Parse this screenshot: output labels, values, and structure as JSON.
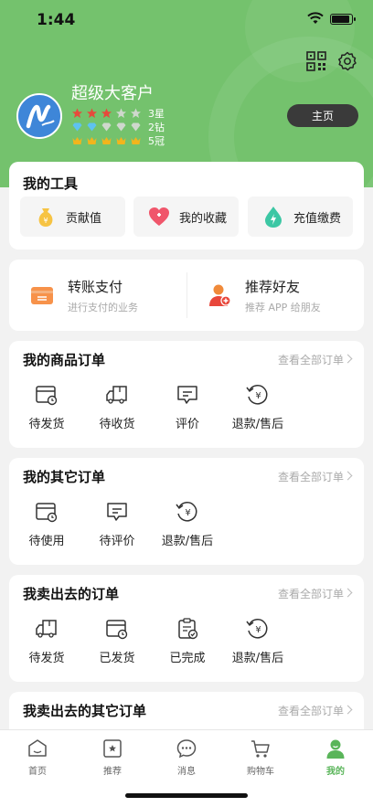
{
  "status_bar": {
    "time": "1:44"
  },
  "header": {
    "icons": [
      "qr-code-icon",
      "gear-icon"
    ],
    "user_name": "超级大客户",
    "levels": [
      {
        "label": "3星",
        "icon": "star-icon"
      },
      {
        "label": "2钻",
        "icon": "diamond-icon"
      },
      {
        "label": "5冠",
        "icon": "crown-icon"
      }
    ],
    "home_button": "主页"
  },
  "tools": {
    "title": "我的工具",
    "items": [
      {
        "label": "贡献值",
        "icon": "money-bag-icon"
      },
      {
        "label": "我的收藏",
        "icon": "heart-icon"
      },
      {
        "label": "充值缴费",
        "icon": "water-drop-icon"
      }
    ]
  },
  "pay": {
    "items": [
      {
        "title": "转账支付",
        "subtitle": "进行支付的业务",
        "icon": "wallet-icon"
      },
      {
        "title": "推荐好友",
        "subtitle": "推荐 APP 给朋友",
        "icon": "user-add-icon"
      }
    ]
  },
  "orders": {
    "see_all": "查看全部订单",
    "goods": {
      "title": "我的商品订单",
      "items": [
        "待发货",
        "待收货",
        "评价",
        "退款/售后"
      ]
    },
    "other": {
      "title": "我的其它订单",
      "items": [
        "待使用",
        "待评价",
        "退款/售后"
      ]
    },
    "sold": {
      "title": "我卖出去的订单",
      "items": [
        "待发货",
        "已发货",
        "已完成",
        "退款/售后"
      ]
    },
    "sold_other": {
      "title": "我卖出去的其它订单"
    }
  },
  "tabbar": {
    "items": [
      {
        "label": "首页",
        "icon": "home-icon"
      },
      {
        "label": "推荐",
        "icon": "recommend-icon"
      },
      {
        "label": "消息",
        "icon": "message-icon"
      },
      {
        "label": "购物车",
        "icon": "cart-icon"
      },
      {
        "label": "我的",
        "icon": "profile-icon"
      }
    ],
    "active_index": 4
  },
  "colors": {
    "brand_green": "#74c26d",
    "active_tab": "#5ab55a",
    "home_button_bg": "#3a3a3a"
  }
}
